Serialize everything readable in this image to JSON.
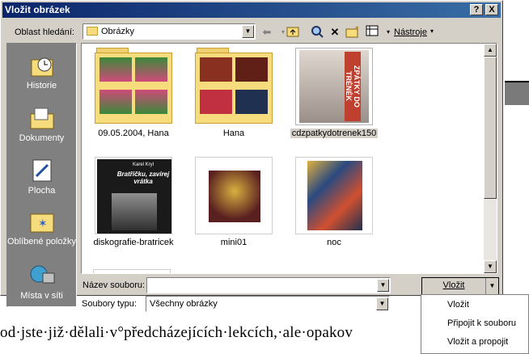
{
  "background_doc": {
    "line1": "...",
    "line2": "od·jste·již·dělali·v°předcházejících·lekcích,·ale·opakov",
    "line3": "..."
  },
  "dialog": {
    "title": "Vložit obrázek",
    "help_button": "?",
    "close_button": "X",
    "look_in_label": "Oblast hledání:",
    "look_in_value": "Obrázky",
    "tools_label": "Nástroje",
    "places": [
      {
        "label": "Historie",
        "icon": "history-icon"
      },
      {
        "label": "Dokumenty",
        "icon": "documents-icon"
      },
      {
        "label": "Plocha",
        "icon": "desktop-icon"
      },
      {
        "label": "Oblíbené položky",
        "icon": "favorites-icon"
      },
      {
        "label": "Místa v síti",
        "icon": "network-places-icon"
      }
    ],
    "files": [
      {
        "name": "09.05.2004, Hana",
        "kind": "folder"
      },
      {
        "name": "Hana",
        "kind": "folder"
      },
      {
        "name": "cdzpatkydotrenek150",
        "kind": "image",
        "selected": true,
        "cover_text": "ZPÁTKY DO TRÉNÉK"
      },
      {
        "name": "diskografie-bratricek",
        "kind": "image",
        "cover_text_1": "Karel Kryl",
        "cover_text_2": "Bratříčku, zavírej vrátka"
      },
      {
        "name": "mini01",
        "kind": "image"
      },
      {
        "name": "noc",
        "kind": "image"
      }
    ],
    "file_name_label": "Název souboru:",
    "file_name_value": "",
    "file_type_label": "Soubory typu:",
    "file_type_value": "Všechny obrázky",
    "insert_button": "Vložit",
    "insert_menu": [
      "Vložit",
      "Připojit k souboru",
      "Vložit a propojit"
    ]
  },
  "colors": {
    "titlebar_start": "#0a246a",
    "titlebar_end": "#3a6ea5",
    "dialog_face": "#d4d0c8",
    "places_bar": "#808080",
    "folder": "#f6dc7c"
  }
}
